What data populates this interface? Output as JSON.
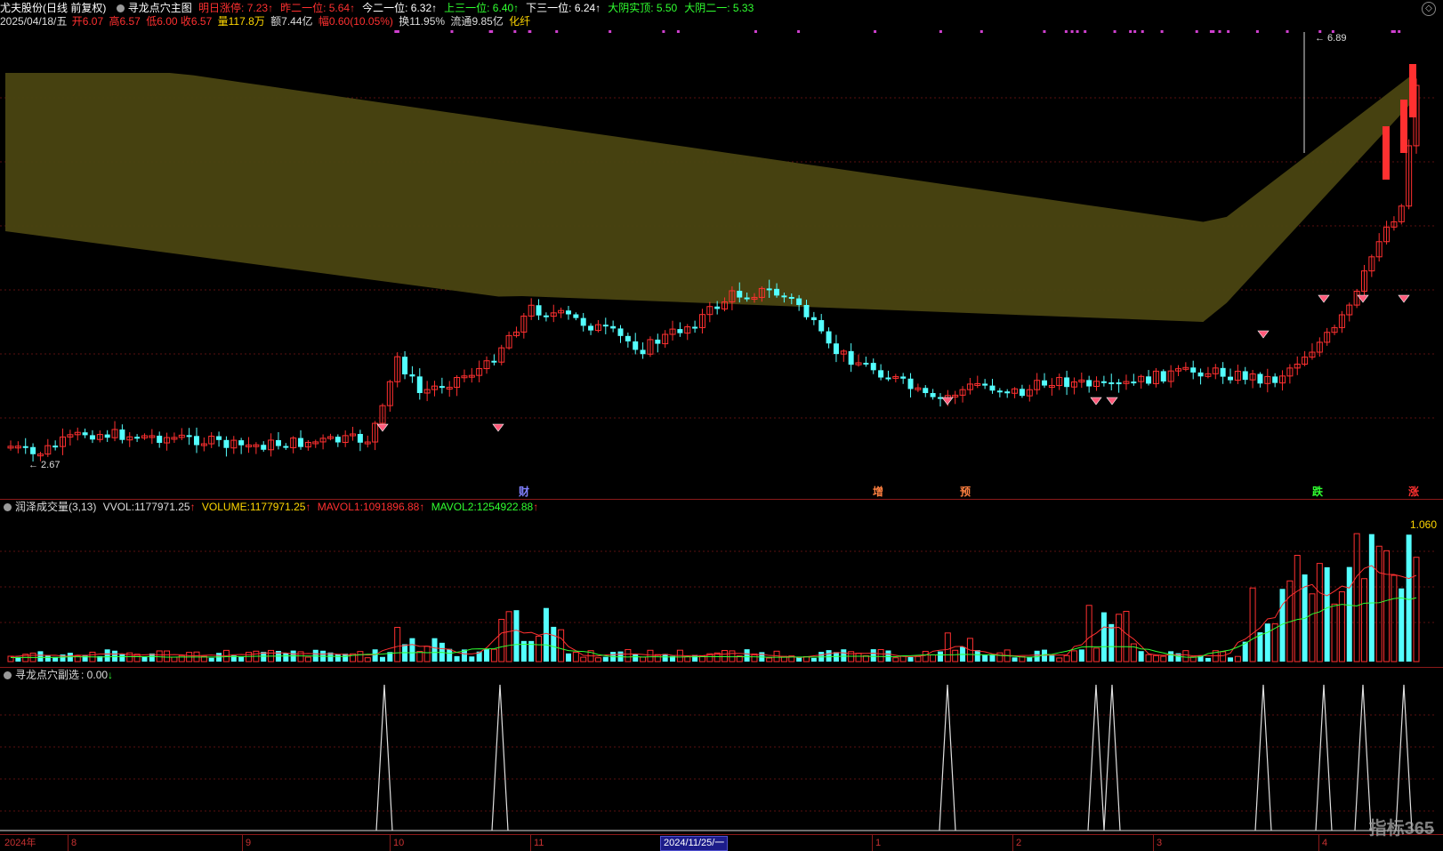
{
  "header": {
    "stock_name": "尤夫股份",
    "period": "(日线 前复权)",
    "indicator": "寻龙点穴主图",
    "items": [
      {
        "label": "明日涨停:",
        "value": "7.23",
        "arrow": "↑",
        "color": "#ff3030"
      },
      {
        "label": "昨二一位:",
        "value": "5.64",
        "arrow": "↑",
        "color": "#ff3030"
      },
      {
        "label": "今二一位:",
        "value": "6.32",
        "arrow": "↑",
        "color": "#ffffff"
      },
      {
        "label": "上三一位:",
        "value": "6.40",
        "arrow": "↑",
        "color": "#30ff30"
      },
      {
        "label": "下三一位:",
        "value": "6.24",
        "arrow": "↑",
        "color": "#ffffff"
      },
      {
        "label": "大阴实顶:",
        "value": "5.50",
        "arrow": "",
        "color": "#30ff30"
      },
      {
        "label": "大阴二一:",
        "value": "5.33",
        "arrow": "",
        "color": "#30ff30"
      }
    ]
  },
  "quote": {
    "date": "2025/04/18/五",
    "open_label": "开",
    "open": "6.07",
    "high_label": "高",
    "high": "6.57",
    "low_label": "低",
    "low": "6.00",
    "close_label": "收",
    "close": "6.57",
    "vol_label": "量",
    "vol": "117.8万",
    "amount_label": "额",
    "amount": "7.44亿",
    "change_label": "幅",
    "change": "0.60(10.05%)",
    "turnover_label": "换",
    "turnover": "11.95%",
    "float_label": "流通",
    "float": "9.85亿",
    "sector": "化纤"
  },
  "main_chart": {
    "max_label": "6.89",
    "min_label": "2.67",
    "markers": [
      {
        "text": "财",
        "color": "#8080ff"
      },
      {
        "text": "增",
        "color": "#ff8040"
      },
      {
        "text": "预",
        "color": "#ff8040"
      },
      {
        "text": "跌",
        "color": "#30ff30"
      },
      {
        "text": "涨",
        "color": "#ff3030"
      }
    ]
  },
  "volume_panel": {
    "name": "润泽成交量(3,13)",
    "vvol_label": "VVOL:",
    "vvol": "1177971.25",
    "volume_label": "VOLUME:",
    "volume": "1177971.25",
    "mavol1_label": "MAVOL1:",
    "mavol1": "1091896.88",
    "mavol2_label": "MAVOL2:",
    "mavol2": "1254922.88",
    "scale_label": "1.060"
  },
  "sub_panel": {
    "name": "寻龙点穴副选",
    "value": ": 0.00",
    "arrow": "↓"
  },
  "time_axis": {
    "labels": [
      "2024年",
      "8",
      "9",
      "10",
      "11",
      "1",
      "2",
      "3",
      "4"
    ],
    "cursor_date": "2024/11/25/一"
  },
  "colors": {
    "up": "#ff3030",
    "down": "#54ffff",
    "band": "#4a4511",
    "ma1": "#ff3030",
    "ma2": "#30ff30",
    "grid": "#5a0f0f"
  },
  "logo": {
    "text": "指标365"
  }
}
